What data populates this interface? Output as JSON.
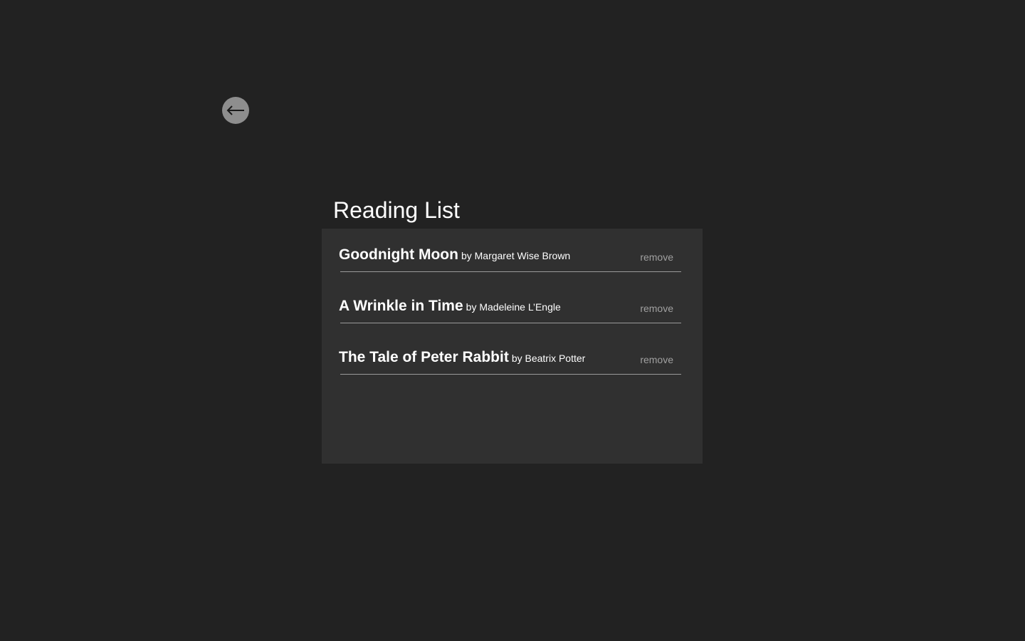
{
  "header": {
    "back_icon": "arrow-left-icon",
    "title": "Reading List"
  },
  "reading_list": {
    "items": [
      {
        "title": "Goodnight Moon",
        "author": "by Margaret Wise Brown",
        "remove_label": "remove"
      },
      {
        "title": "A Wrinkle in Time",
        "author": "by Madeleine L’Engle",
        "remove_label": "remove"
      },
      {
        "title": "The Tale of Peter Rabbit",
        "author": "by Beatrix Potter",
        "remove_label": "remove"
      }
    ]
  },
  "colors": {
    "background": "#222222",
    "panel": "#303030",
    "back_button": "#8e8e8e",
    "divider": "#9a9a9a",
    "remove_text": "#a0a0a0"
  }
}
